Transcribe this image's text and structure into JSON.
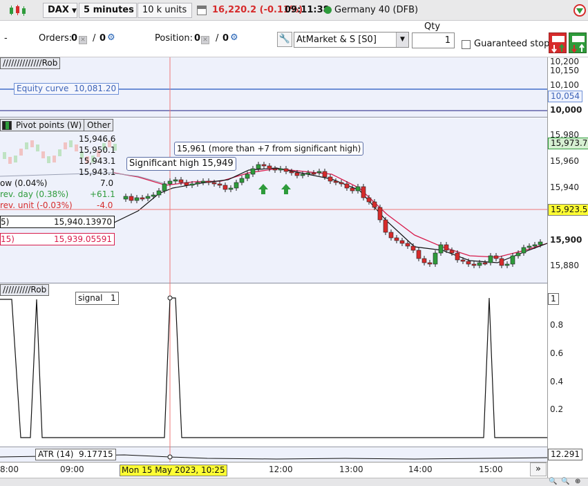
{
  "toolbar": {
    "symbol": "DAX",
    "timeframe": "5 minutes",
    "units": "10 k units",
    "price": "16,220.2 (-0.11%)",
    "time": "09:11:38",
    "market": "Germany 40 (DFB)",
    "up_color": "#2e9b3b",
    "down_color": "#d62b2b"
  },
  "order_bar": {
    "dash": "-",
    "orders_label": "Orders:",
    "orders_count": "0",
    "orders_count2": "0",
    "position_label": "Position:",
    "position_count": "0",
    "position_count2": "0",
    "order_type": "AtMarket & S [S0]",
    "qty_label": "Qty",
    "qty_value": "1",
    "guaranteed_stop": "Guaranteed stop"
  },
  "equity_pane": {
    "title": "//////////////Rob",
    "equity_label": "Equity curve",
    "equity_value": "10,081.20",
    "y_ticks": [
      "10,200",
      "10,150",
      "10,100",
      "10,054",
      "10,000"
    ]
  },
  "price_pane": {
    "pivot_label": "Pivot points (W)",
    "other_label": "Other",
    "levels": [
      "15,946.6",
      "15,950.1",
      "15,943.1",
      "15,943.1"
    ],
    "var_low": "ow (0.04%)",
    "var_low_val": "7.0",
    "var_day": "rev. day (0.38%)",
    "var_day_val": "+61.1",
    "var_unit": "rev. unit (-0.03%)",
    "var_unit_val": "-4.0",
    "ma1_label": "5)",
    "ma1_value": "15,940.13970",
    "ma2_label": "15)",
    "ma2_value": "15,939.05591",
    "sig_high_label": "Significant high 15,949",
    "sig_note": "15,961 (more than +7 from significant high)",
    "y_ticks": [
      "15,980",
      "15,973.7",
      "15,960",
      "15,940",
      "15,923.5",
      "15,900",
      "15,880"
    ],
    "current_price": "15,973.7",
    "cursor_price": "15,923.5"
  },
  "signal_pane": {
    "title": "//////////Rob",
    "signal_label": "signal",
    "signal_value": "1",
    "y_ticks": [
      "1",
      "0.8",
      "0.6",
      "0.4",
      "0.2"
    ]
  },
  "atr_pane": {
    "label": "ATR (14)",
    "value": "9.17715",
    "axis_value": "12.291"
  },
  "time_axis": {
    "labels": [
      "8:00",
      "09:00",
      "12:00",
      "13:00",
      "14:00",
      "15:00"
    ],
    "cursor_time": "Mon 15 May 2023, 10:25",
    "more": "»"
  }
}
